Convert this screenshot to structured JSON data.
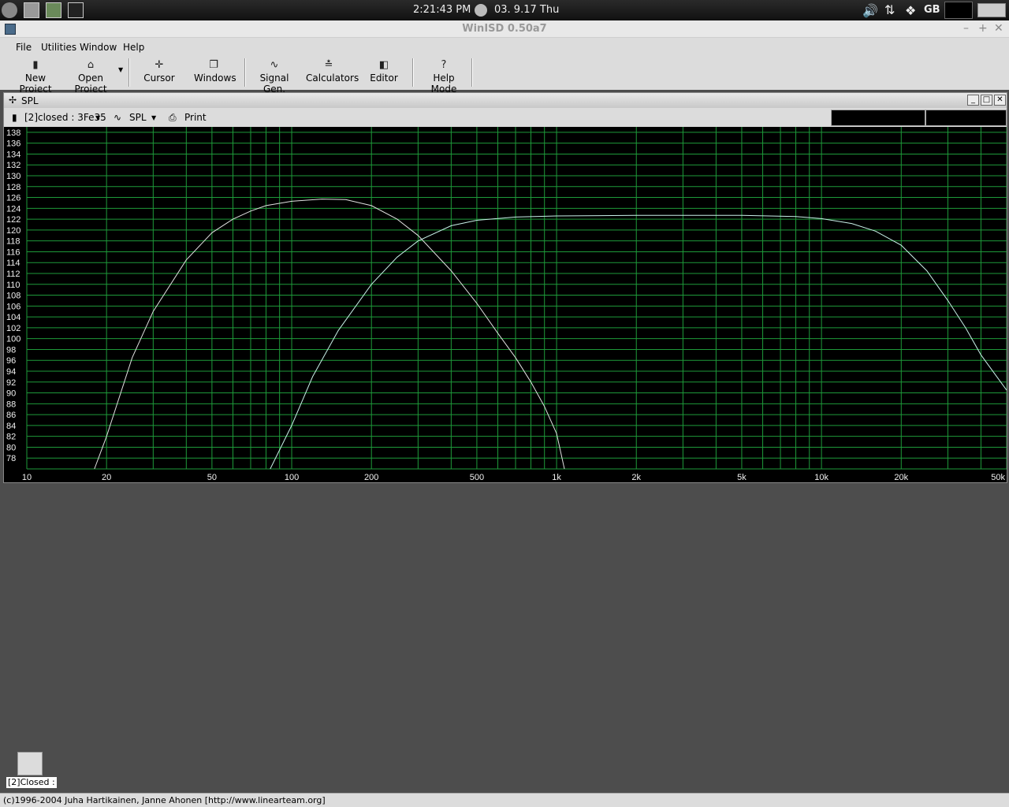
{
  "panel": {
    "time": "2:21:43 PM",
    "date": "03. 9.17 Thu",
    "keyboard": "GB"
  },
  "window": {
    "title": "WinISD 0.50a7"
  },
  "menu": [
    "File",
    "Utilities",
    "Window",
    "Help"
  ],
  "toolbar": [
    {
      "label": "New Project",
      "icon": "new-project-icon"
    },
    {
      "label": "Open Project",
      "icon": "open-folder-icon"
    },
    {
      "label": "Cursor",
      "icon": "cursor-crosshair-icon"
    },
    {
      "label": "Windows",
      "icon": "windows-stack-icon"
    },
    {
      "label": "Signal Gen.",
      "icon": "sine-wave-icon"
    },
    {
      "label": "Calculators",
      "icon": "calculator-icon"
    },
    {
      "label": "Editor",
      "icon": "speaker-editor-icon"
    },
    {
      "label": "Help Mode",
      "icon": "question-mark-icon"
    }
  ],
  "spl": {
    "title": "SPL",
    "project_select": "[2]closed : 3Fe35",
    "graph_select": "SPL",
    "print": "Print"
  },
  "chart_data": {
    "type": "line",
    "title": "",
    "xlabel": "",
    "ylabel": "",
    "x_scale": "log",
    "xlim": [
      10,
      50000
    ],
    "ylim": [
      76,
      139
    ],
    "grid": true,
    "x_tick_labels": [
      "10",
      "20",
      "50",
      "100",
      "200",
      "500",
      "1k",
      "2k",
      "5k",
      "10k",
      "20k",
      "50k"
    ],
    "x_tick_values": [
      10,
      20,
      50,
      100,
      200,
      500,
      1000,
      2000,
      5000,
      10000,
      20000,
      50000
    ],
    "y_ticks": [
      78,
      80,
      82,
      84,
      86,
      88,
      90,
      92,
      94,
      96,
      98,
      100,
      102,
      104,
      106,
      108,
      110,
      112,
      114,
      116,
      118,
      120,
      122,
      124,
      126,
      128,
      130,
      132,
      134,
      136,
      138
    ],
    "series": [
      {
        "color": "#e0e0e0",
        "x": [
          18,
          20,
          25,
          30,
          40,
          50,
          60,
          70,
          80,
          100,
          130,
          160,
          200,
          250,
          300,
          400,
          500,
          600,
          700,
          800,
          900,
          1000,
          1070
        ],
        "y": [
          76,
          82,
          96.5,
          105,
          114.5,
          119.5,
          122,
          123.5,
          124.5,
          125.3,
          125.7,
          125.6,
          124.5,
          122,
          119,
          112.5,
          106.5,
          101,
          96.5,
          92,
          87.5,
          82.5,
          76
        ]
      },
      {
        "color": "#c8f0e8",
        "x": [
          83,
          100,
          120,
          150,
          200,
          250,
          300,
          400,
          500,
          700,
          1000,
          2000,
          5000,
          8000,
          10000,
          13000,
          16000,
          20000,
          25000,
          30000,
          35000,
          40000,
          50000
        ],
        "y": [
          76,
          84,
          93,
          101.5,
          110,
          115,
          118,
          120.8,
          121.8,
          122.4,
          122.6,
          122.7,
          122.7,
          122.5,
          122.1,
          121.2,
          119.8,
          117.2,
          112.5,
          107,
          102,
          97,
          90.5
        ]
      }
    ]
  },
  "minimized": {
    "label": "[2]Closed :"
  },
  "status": {
    "text": "(c)1996-2004 Juha Hartikainen, Janne Ahonen [http://www.linearteam.org]"
  }
}
